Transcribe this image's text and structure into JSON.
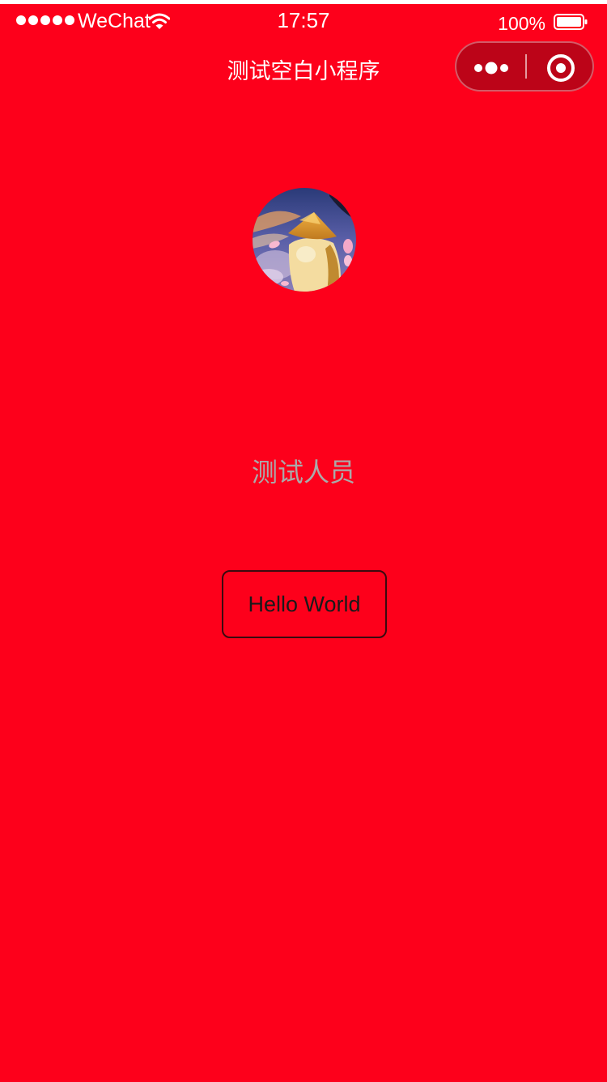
{
  "status_bar": {
    "carrier": "WeChat",
    "time": "17:57",
    "battery": "100%",
    "signal_icon": "signal-dots-icon",
    "wifi_icon": "wifi-icon",
    "battery_icon": "battery-icon"
  },
  "nav": {
    "title": "测试空白小程序",
    "more_icon": "more-dots-icon",
    "close_icon": "close-target-icon"
  },
  "user": {
    "nickname": "测试人员",
    "avatar": "avatar-image"
  },
  "button": {
    "label": "Hello World"
  },
  "colors": {
    "background": "#fd001b",
    "capsule": "#bc0418",
    "nickname": "#aaaaaa",
    "button_text": "#1a1a1a"
  }
}
